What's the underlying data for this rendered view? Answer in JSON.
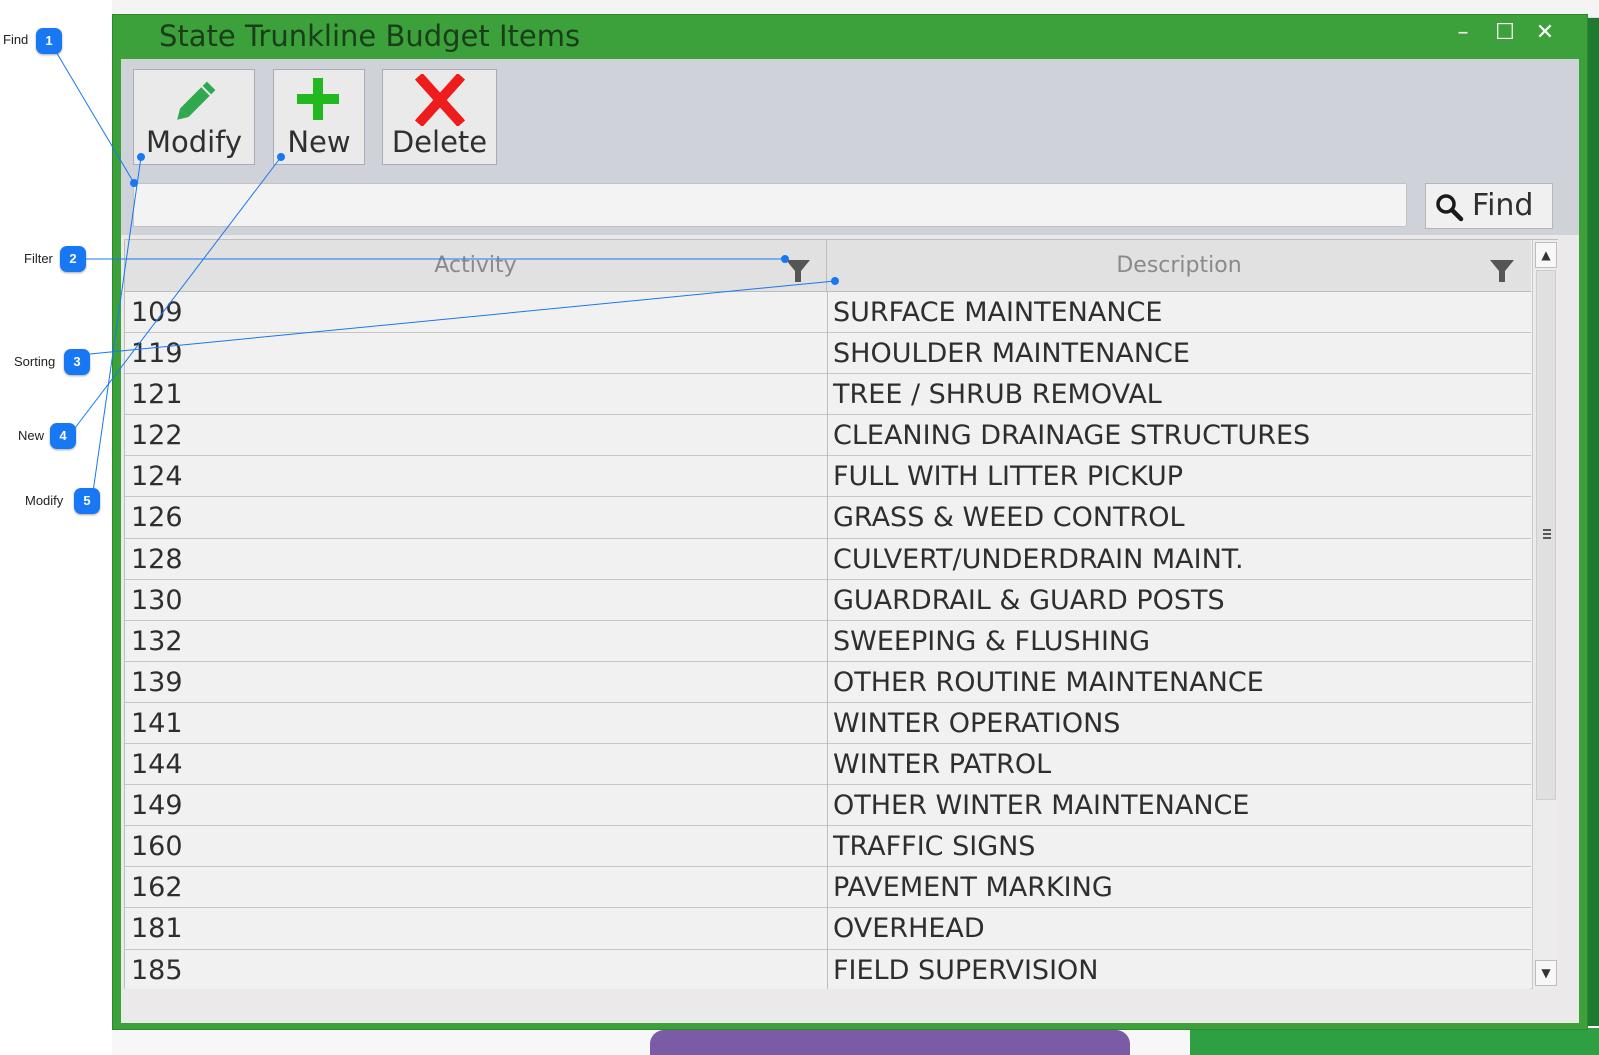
{
  "window": {
    "title": "State Trunkline Budget Items",
    "controls": {
      "minimize": "–",
      "maximize": "☐",
      "close": "✕"
    }
  },
  "toolbar": {
    "modify_label": "Modify",
    "new_label": "New",
    "delete_label": "Delete",
    "icons": {
      "modify": "pencil-icon",
      "new": "plus-icon",
      "delete": "x-icon"
    },
    "icon_colors": {
      "modify": "#2fa84f",
      "new": "#22b820",
      "delete": "#ee1c1c"
    }
  },
  "search": {
    "value": "",
    "placeholder": "",
    "find_label": "Find"
  },
  "grid": {
    "columns": [
      {
        "label": "Activity"
      },
      {
        "label": "Description"
      }
    ],
    "rows": [
      {
        "activity": "109",
        "description": "SURFACE MAINTENANCE"
      },
      {
        "activity": "119",
        "description": "SHOULDER MAINTENANCE"
      },
      {
        "activity": "121",
        "description": "TREE / SHRUB REMOVAL"
      },
      {
        "activity": "122",
        "description": "CLEANING DRAINAGE STRUCTURES"
      },
      {
        "activity": "124",
        "description": "FULL WITH LITTER PICKUP"
      },
      {
        "activity": "126",
        "description": "GRASS & WEED CONTROL"
      },
      {
        "activity": "128",
        "description": "CULVERT/UNDERDRAIN MAINT."
      },
      {
        "activity": "130",
        "description": "GUARDRAIL & GUARD POSTS"
      },
      {
        "activity": "132",
        "description": "SWEEPING & FLUSHING"
      },
      {
        "activity": "139",
        "description": "OTHER ROUTINE MAINTENANCE"
      },
      {
        "activity": "141",
        "description": "WINTER OPERATIONS"
      },
      {
        "activity": "144",
        "description": "WINTER PATROL"
      },
      {
        "activity": "149",
        "description": "OTHER WINTER MAINTENANCE"
      },
      {
        "activity": "160",
        "description": "TRAFFIC SIGNS"
      },
      {
        "activity": "162",
        "description": "PAVEMENT MARKING"
      },
      {
        "activity": "181",
        "description": "OVERHEAD"
      },
      {
        "activity": "185",
        "description": "FIELD SUPERVISION"
      }
    ]
  },
  "callouts": [
    {
      "number": "1",
      "label": "Find"
    },
    {
      "number": "2",
      "label": "Filter"
    },
    {
      "number": "3",
      "label": "Sorting"
    },
    {
      "number": "4",
      "label": "New"
    },
    {
      "number": "5",
      "label": "Modify"
    }
  ],
  "colors": {
    "window_frame": "#3ca13a",
    "callout_badge": "#1877f2"
  }
}
